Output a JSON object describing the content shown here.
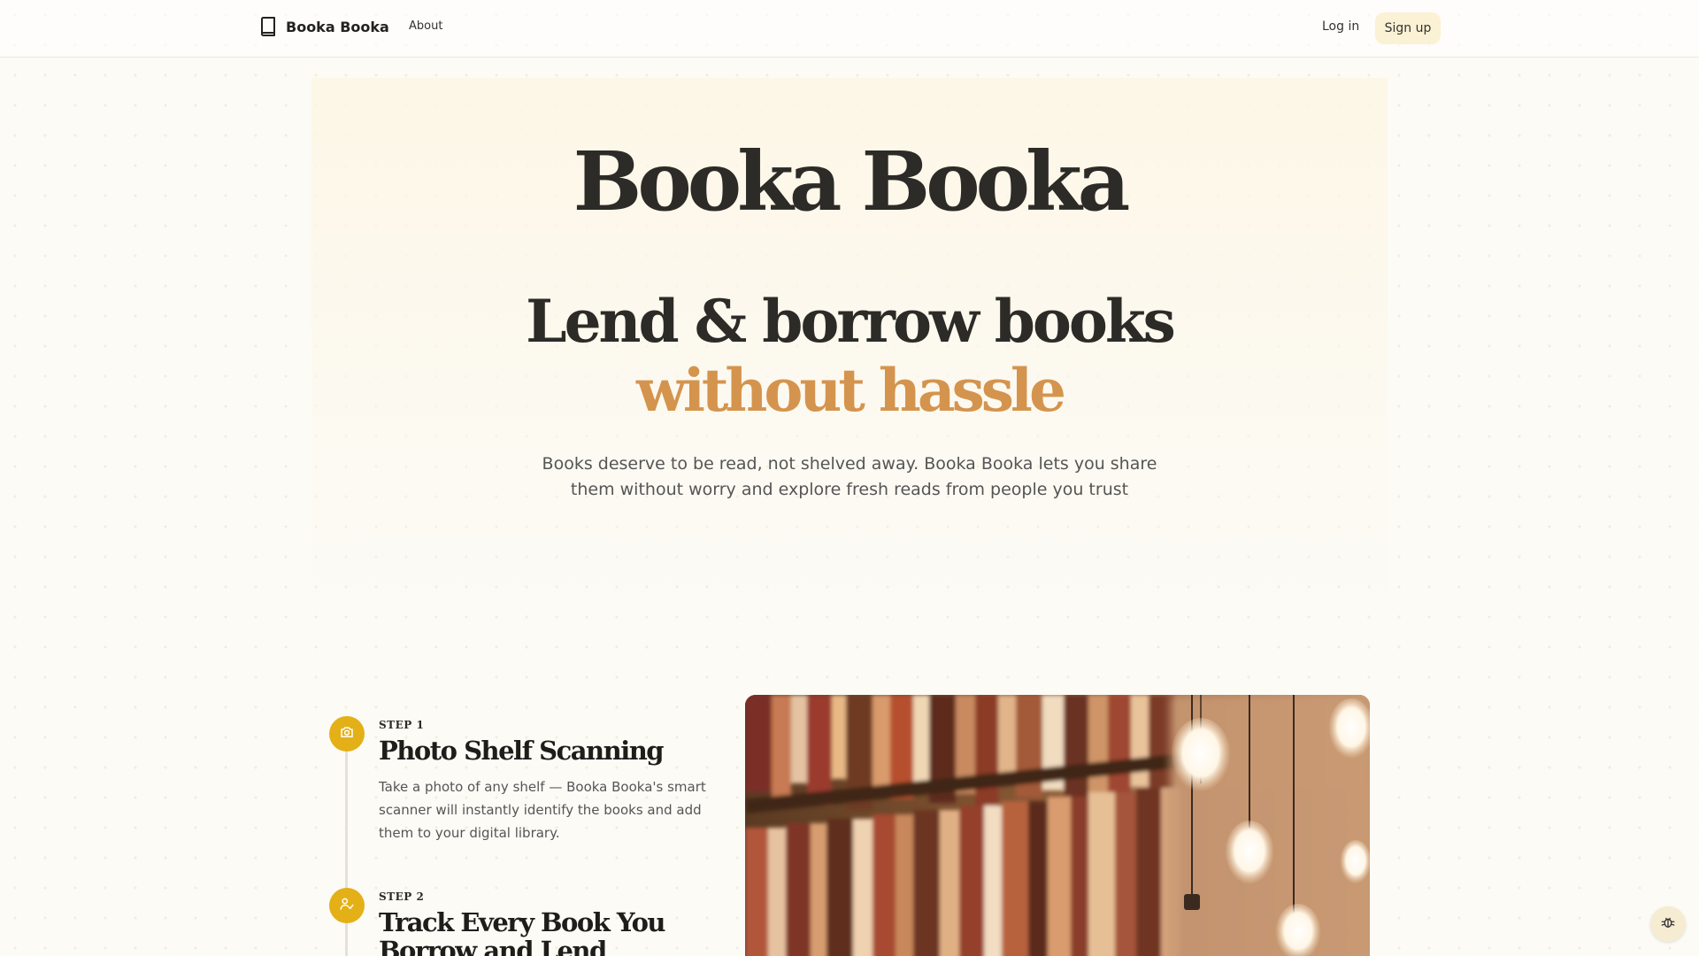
{
  "nav": {
    "brand": "Booka Booka",
    "about": "About",
    "login": "Log in",
    "signup": "Sign up"
  },
  "hero": {
    "title": "Booka Booka",
    "headline": "Lend & borrow books",
    "accent": "without hassle",
    "subtitle": "Books deserve to be read, not shelved away. Booka Booka lets you share them without worry and explore fresh reads from people you trust"
  },
  "steps": [
    {
      "label": "STEP 1",
      "title": "Photo Shelf Scanning",
      "description": "Take a photo of any shelf — Booka Booka's smart scanner will instantly identify the books and add them to your digital library.",
      "icon": "camera-icon"
    },
    {
      "label": "STEP 2",
      "title": "Track Every Book You Borrow and Lend",
      "icon": "user-check-icon"
    }
  ],
  "colors": {
    "accent": "#d4944e",
    "step_dot": "#e4b017",
    "signup_bg": "#fbf1d4",
    "background": "#fcfbf6"
  },
  "icons": {
    "brand": "book-icon",
    "debug": "bug-icon"
  }
}
